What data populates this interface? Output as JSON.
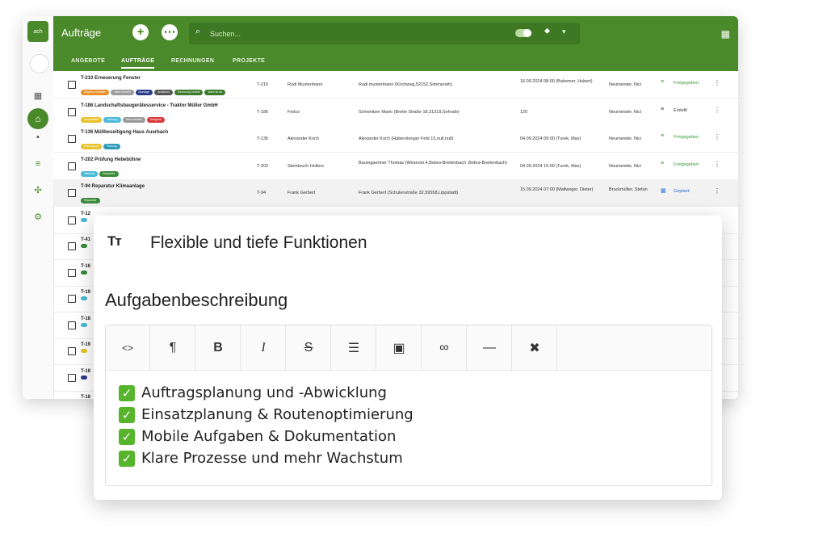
{
  "app": {
    "logo_text": "ach",
    "title": "Aufträge",
    "search_placeholder": "Suchen...",
    "tabs": [
      {
        "label": "ANGEBOTE",
        "active": false
      },
      {
        "label": "AUFTRÄGE",
        "active": true
      },
      {
        "label": "RECHNUNGEN",
        "active": false
      },
      {
        "label": "PROJEKTE",
        "active": false
      }
    ],
    "colors": {
      "brand": "#4a8a2a",
      "released": "#3a9a3a",
      "planned": "#2c6fd6"
    },
    "rows": [
      {
        "title": "T-210 Erneuerung Fenster",
        "tags": [
          {
            "label": "Angebot erstellen",
            "color": "#e8902c"
          },
          {
            "label": "Ware bestellt",
            "color": "#9a9a9a"
          },
          {
            "label": "Montage",
            "color": "#2a3a8a"
          },
          {
            "label": "Abnahme",
            "color": "#555555"
          },
          {
            "label": "Rechnung erstellt",
            "color": "#3a7a2a"
          },
          {
            "label": "Ware ist da",
            "color": "#3a7a2a"
          }
        ],
        "number": "T-210",
        "contact": "Rudi Mustermann",
        "address": "Rudi mustermann (Kirchweg,52152,Simmerath)",
        "date": "16.09.2024 08:00 (Bahemer, Hubert)",
        "assignee": "Neumeister, Nici",
        "status": "Freigegeben",
        "status_kind": "released"
      },
      {
        "title": "T-186 Landschaftsbaugerätesservice - Traktor Müller GmbH",
        "tags": [
          {
            "label": "Ausgeliefert",
            "color": "#e8c22c"
          },
          {
            "label": "Wartung",
            "color": "#4ab8d8"
          },
          {
            "label": "Ware bestellt",
            "color": "#9a9a9a"
          },
          {
            "label": "Dringend",
            "color": "#d83a3a"
          }
        ],
        "number": "T-186",
        "contact": "Fedco",
        "address": "Schweitzer Mario (Breite Straße 18,31319,Sehnde)",
        "date": "120",
        "assignee": "Neumeister, Nici",
        "status": "Erstellt",
        "status_kind": "created"
      },
      {
        "title": "T-136 Müllbeseitigung Haus Auerbach",
        "tags": [
          {
            "label": "Entsorgung",
            "color": "#e8c22c"
          },
          {
            "label": "Planung",
            "color": "#2a9ab8"
          }
        ],
        "number": "T-136",
        "contact": "Alexander Koch",
        "address": "Alexander Koch (Haberstenger Feld 15,null,null)",
        "date": "04.09.2024 09:00 (Turek, Max)",
        "assignee": "Neumeister, Nici",
        "status": "Freigegeben",
        "status_kind": "released"
      },
      {
        "title": "T-202 Prüfung Hebebühne",
        "tags": [
          {
            "label": "Wartung",
            "color": "#4ab8d8"
          },
          {
            "label": "Reparatur",
            "color": "#3a8a3a"
          }
        ],
        "number": "T-202",
        "contact": "Steinbruch Hollers",
        "address": "Baumgaertner Thomas (Weserstr.4,Bebra-Breitenbach ,Bebra-Breitenbach)",
        "date": "04.09.2024 15:00 (Turek, Max)",
        "assignee": "Neumeister, Nici",
        "status": "Freigegeben",
        "status_kind": "released"
      },
      {
        "title": "T-94 Reparatur Klimaanlage",
        "tags": [
          {
            "label": "Reparatur",
            "color": "#3a8a3a"
          }
        ],
        "number": "T-94",
        "contact": "Frank Gerbert",
        "address": "Frank Gerbert (Schulenstraße 32,59558,Lippstadt)",
        "date": "15.09.2024 07:00 (Mallweger, Dieter)",
        "assignee": "Bruckmüller, Stefan",
        "status": "Geplant",
        "status_kind": "planned"
      }
    ],
    "stub_rows": [
      {
        "title": "T-12",
        "color": "#4ab8d8"
      },
      {
        "title": "T-41",
        "color": "#3a8a3a"
      },
      {
        "title": "T-16",
        "color": "#3a8a3a"
      },
      {
        "title": "T-19",
        "color": "#4ab8d8"
      },
      {
        "title": "T-18",
        "color": "#4ab8d8"
      },
      {
        "title": "T-19",
        "color": "#e8c22c"
      },
      {
        "title": "T-18",
        "color": "#2a3a8a"
      },
      {
        "title": "T-18",
        "color": "#d83a8a"
      }
    ]
  },
  "card": {
    "icon_glyph": "Tт",
    "feature_title": "Flexible und tiefe Funktionen",
    "section_title": "Aufgabenbeschreibung",
    "toolbar": [
      {
        "name": "code-icon",
        "glyph": "<>"
      },
      {
        "name": "paragraph-icon",
        "glyph": "¶"
      },
      {
        "name": "bold-icon",
        "glyph": "B"
      },
      {
        "name": "italic-icon",
        "glyph": "I"
      },
      {
        "name": "strikethrough-icon",
        "glyph": "S"
      },
      {
        "name": "list-icon",
        "glyph": "☰"
      },
      {
        "name": "image-icon",
        "glyph": "▣"
      },
      {
        "name": "link-icon",
        "glyph": "∞"
      },
      {
        "name": "horizontal-rule-icon",
        "glyph": "—"
      },
      {
        "name": "clear-format-icon",
        "glyph": "✖"
      }
    ],
    "checklist": [
      "Auftragsplanung und -Abwicklung",
      "Einsatzplanung & Routenoptimierung",
      "Mobile Aufgaben & Dokumentation",
      "Klare Prozesse und mehr Wachstum"
    ],
    "check_glyph": "✓",
    "check_color": "#56b52c"
  }
}
